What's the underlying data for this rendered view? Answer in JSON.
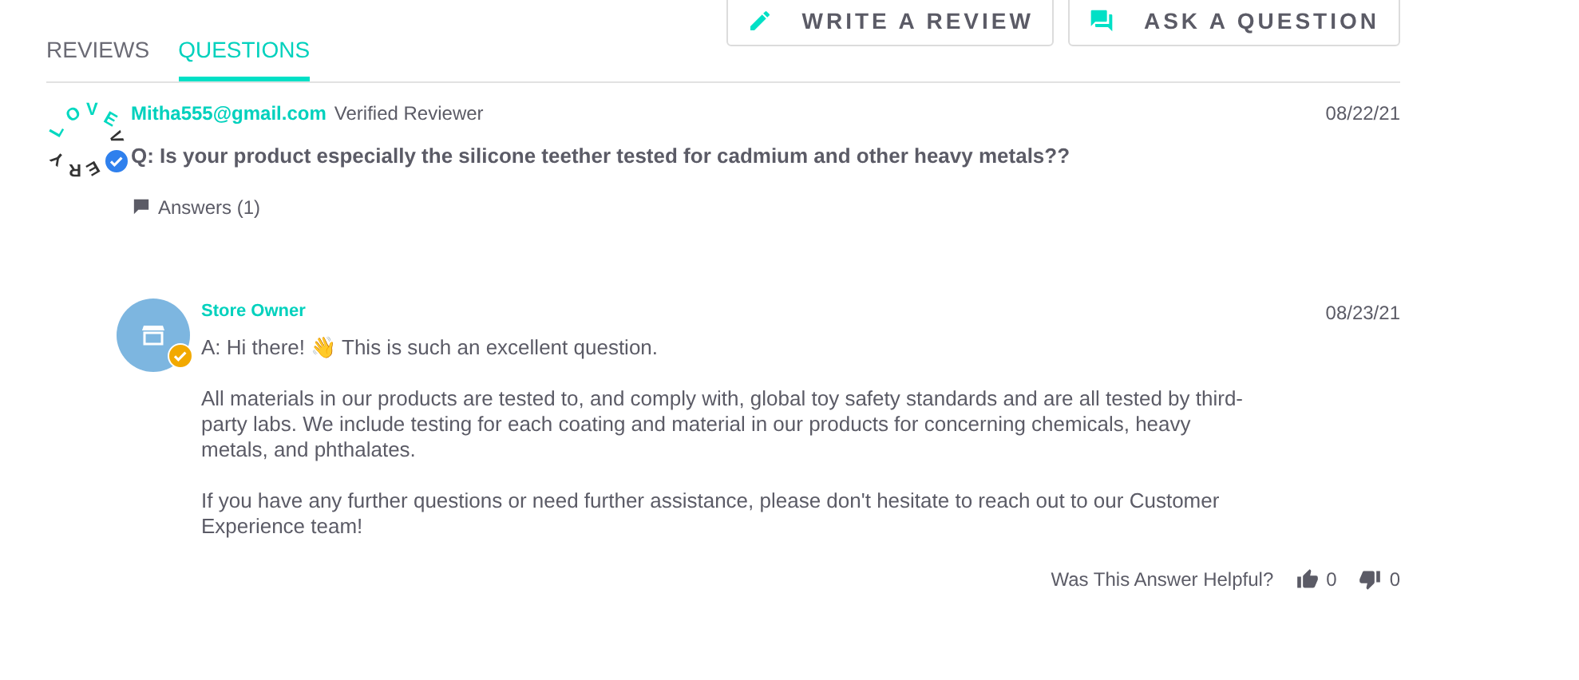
{
  "actions": [
    {
      "label": "WRITE A REVIEW",
      "kind": "pencil"
    },
    {
      "label": "ASK A QUESTION",
      "kind": "chat"
    }
  ],
  "tabs": [
    {
      "label": "REVIEWS",
      "selected": false
    },
    {
      "label": "QUESTIONS",
      "selected": true
    }
  ],
  "question": {
    "logo_text": "LOVEVERY",
    "verified": true,
    "author": "Mitha555@gmail.com",
    "role": "Verified Reviewer",
    "date": "08/22/21",
    "text": "Q: Is your product especially the silicone teether tested for cadmium and other heavy metals??",
    "answers_link": "Answers (1)"
  },
  "answer": {
    "author": "Store Owner",
    "verified": true,
    "date": "08/23/21",
    "paragraphs": [
      "A: Hi there! 👋 This is such an excellent question.",
      "All materials in our products are tested to, and comply with, global toy safety standards and are all tested by third-party labs. We include testing for each coating and material in our products for concerning chemicals, heavy metals, and phthalates.",
      "If you have any further questions or need further assistance, please don't hesitate to reach out to our Customer Experience team!"
    ],
    "helpful_label": "Was This Answer Helpful?",
    "up_count": "0",
    "down_count": "0"
  }
}
